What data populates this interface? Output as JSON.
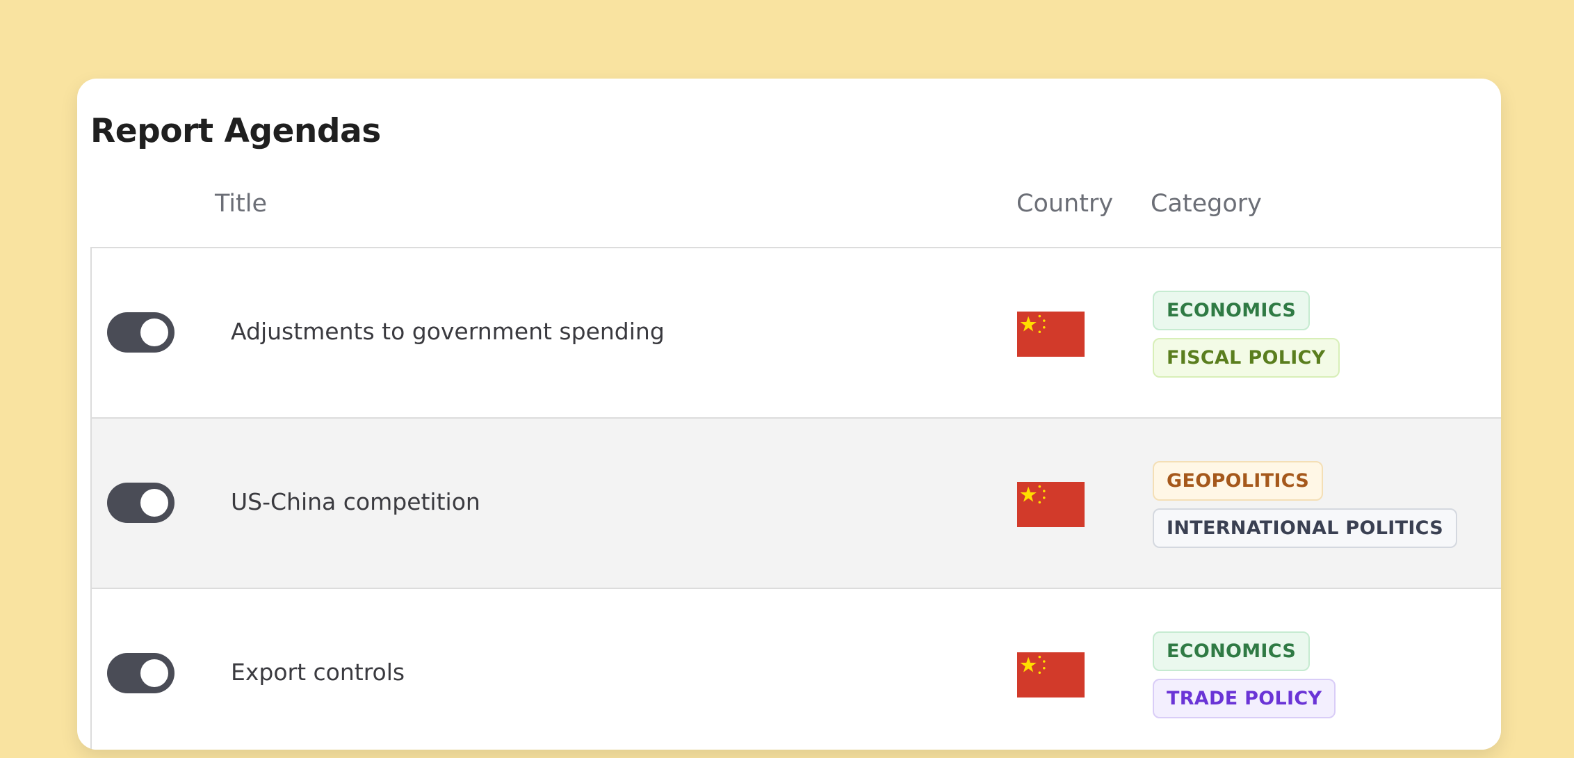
{
  "page": {
    "title": "Report Agendas"
  },
  "table": {
    "headers": {
      "title": "Title",
      "country": "Country",
      "category": "Category"
    },
    "rows": [
      {
        "enabled": true,
        "title": "Adjustments to government spending",
        "country_flag": "china-flag-icon",
        "categories": [
          "ECONOMICS",
          "FISCAL POLICY"
        ]
      },
      {
        "enabled": true,
        "title": "US-China competition",
        "country_flag": "china-flag-icon",
        "categories": [
          "GEOPOLITICS",
          "INTERNATIONAL POLITICS"
        ]
      },
      {
        "enabled": true,
        "title": "Export controls",
        "country_flag": "china-flag-icon",
        "categories": [
          "ECONOMICS",
          "TRADE POLICY"
        ]
      }
    ]
  },
  "colors": {
    "background": "#f9e3a0",
    "toggle_on": "#4a4c56",
    "flag_red": "#d23a2a",
    "flag_star": "#ffde00",
    "economics": "#2f7a44",
    "fiscal_policy": "#5a7e1e",
    "geopolitics": "#a5581b",
    "international_politics": "#3a4052",
    "trade_policy": "#6a34d6"
  }
}
